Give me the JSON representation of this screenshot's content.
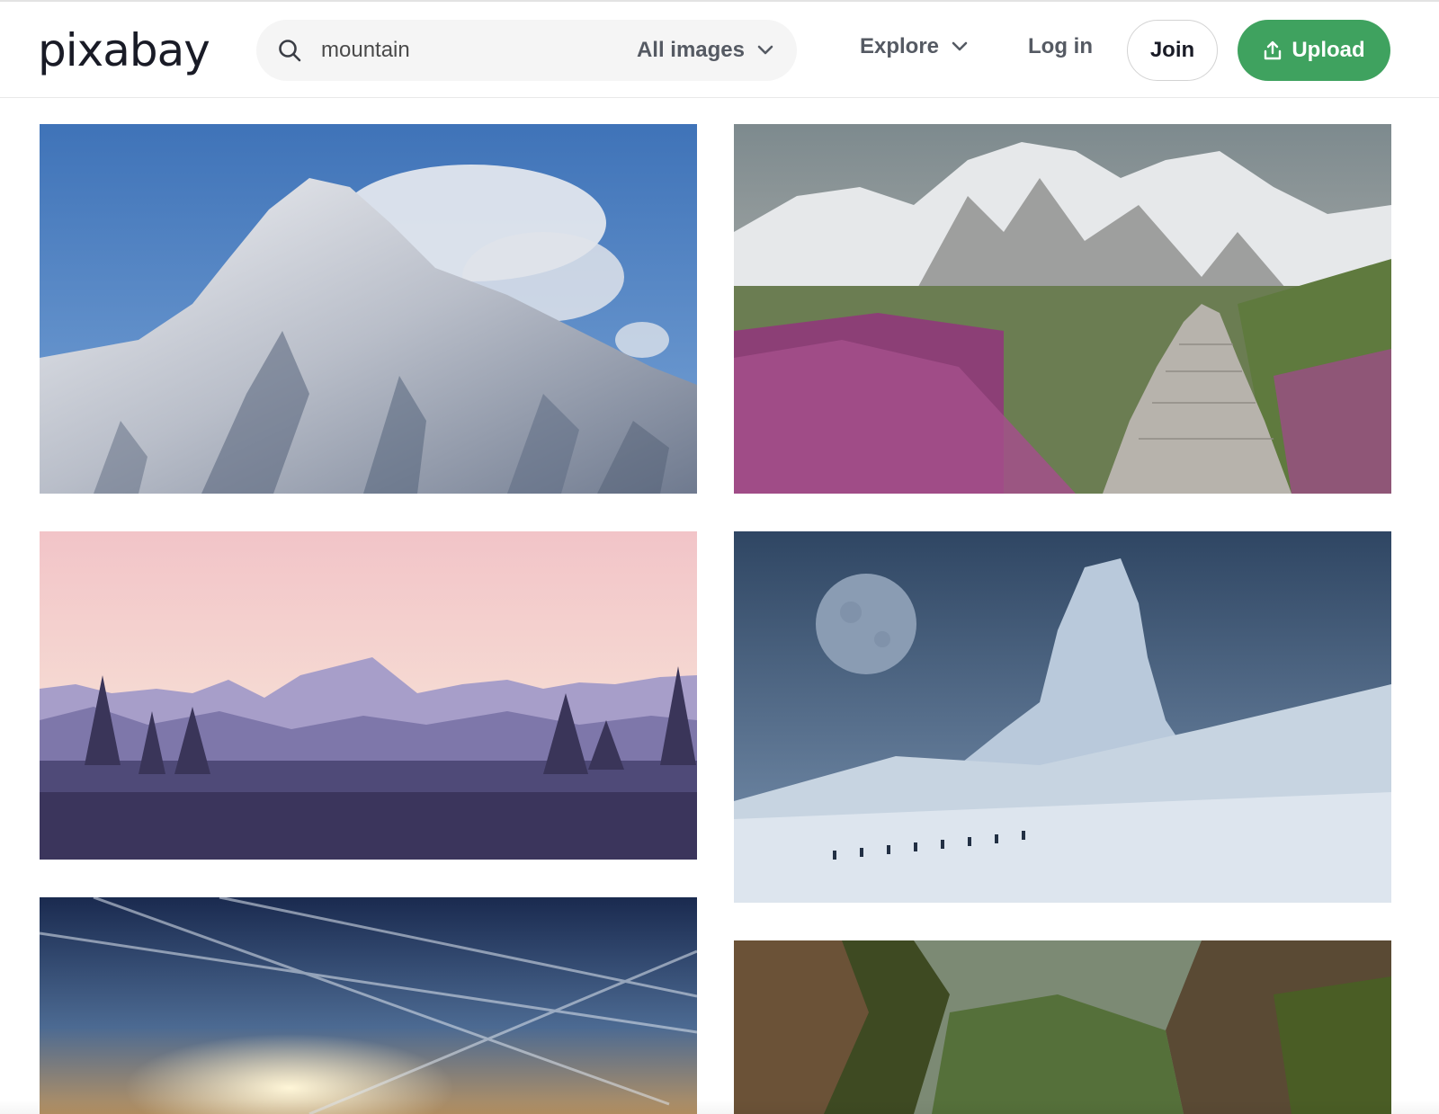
{
  "brand": {
    "logo_text": "pixabay"
  },
  "search": {
    "icon": "search-icon",
    "value": "mountain",
    "filter_label": "All images"
  },
  "nav": {
    "explore_label": "Explore",
    "login_label": "Log in",
    "join_label": "Join",
    "upload_label": "Upload"
  },
  "colors": {
    "accent_green": "#3fa25f",
    "text_dark": "#191b26",
    "text_muted": "#555a63",
    "search_bg": "#f5f5f5"
  },
  "results": [
    {
      "subject": "snowy-mountain-peak"
    },
    {
      "subject": "mountain-stone-path-heather"
    },
    {
      "subject": "mountain-silhouette-sunset"
    },
    {
      "subject": "giant-statue-snow-moon"
    },
    {
      "subject": "sky-contrails-sunrise"
    },
    {
      "subject": "green-canyon-cliffs"
    }
  ]
}
